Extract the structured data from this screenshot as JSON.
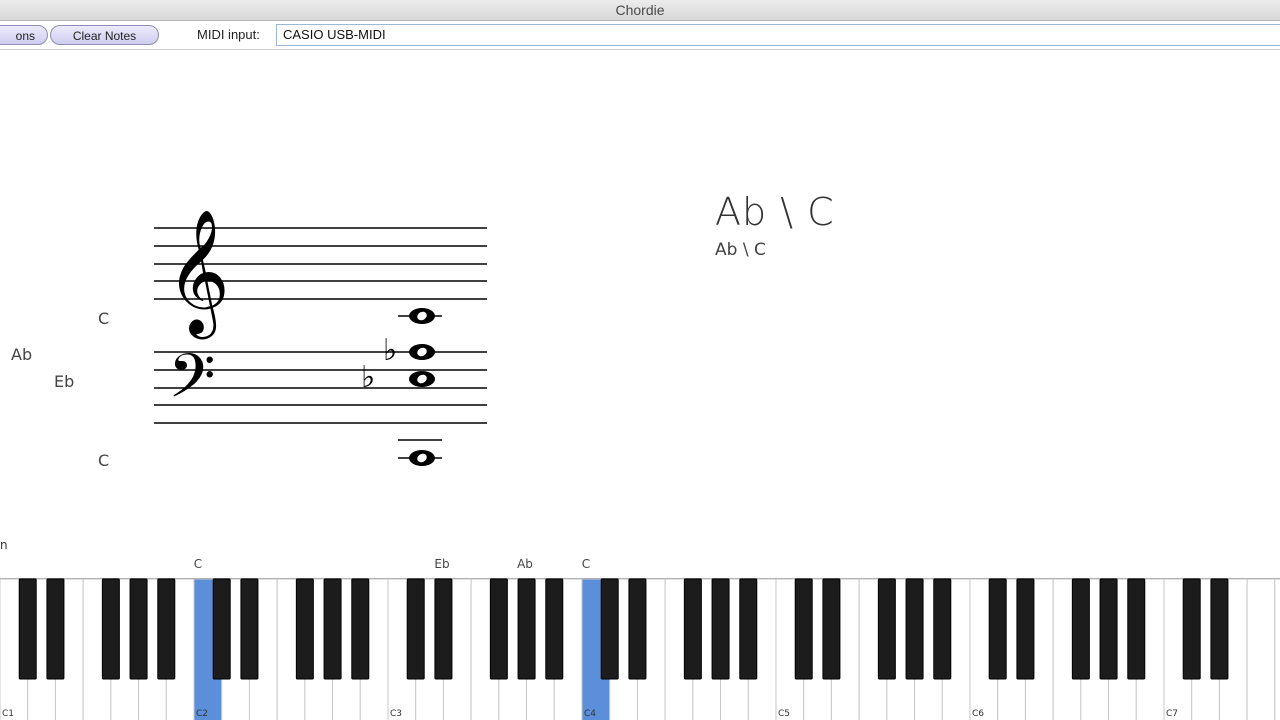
{
  "window": {
    "title": "Chordie"
  },
  "toolbar": {
    "left_button_label": "ons",
    "clear_notes_label": "Clear Notes",
    "midi_input_label": "MIDI input:",
    "midi_input_value": "CASIO USB-MIDI"
  },
  "staff_labels": [
    {
      "text": "C"
    },
    {
      "text": "Ab"
    },
    {
      "text": "Eb"
    },
    {
      "text": "C"
    }
  ],
  "chord": {
    "name": "Ab \\ C",
    "subtitle": "Ab \\ C"
  },
  "stray_text": "n",
  "keyboard": {
    "note_labels": [
      "C",
      "Eb",
      "Ab",
      "C"
    ],
    "octave_labels": [
      "C1",
      "C2",
      "C3",
      "C4",
      "C5",
      "C6",
      "C7"
    ],
    "highlighted_keys": [
      "C2",
      "C4"
    ],
    "highlight_color": "#5b8fd9"
  }
}
